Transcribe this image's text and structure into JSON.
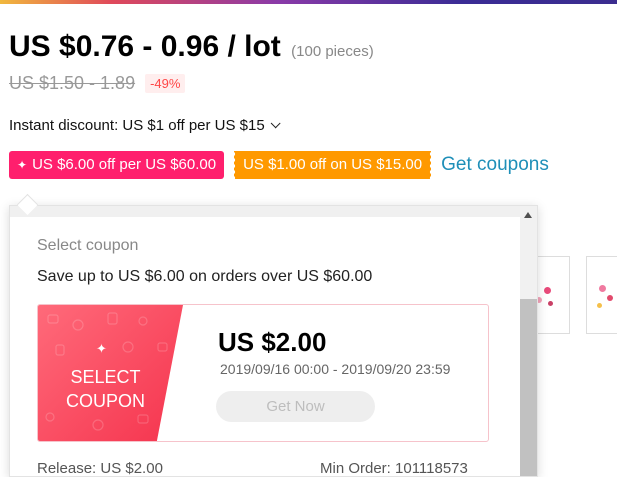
{
  "product": {
    "price_range": "US $0.76 - 0.96 / lot",
    "unit_note": "(100 pieces)",
    "original_price": "US $1.50 - 1.89",
    "discount_percent": "-49%"
  },
  "instant_discount": {
    "label": "Instant discount: US $1 off per US $15"
  },
  "coupon_tags": {
    "store_coupon": "US $6.00 off per US $60.00",
    "select_coupon": "US $1.00 off on US $15.00",
    "get_coupons_link": "Get coupons"
  },
  "popup": {
    "title": "Select coupon",
    "save_text": "Save up to US $6.00 on orders over US $60.00",
    "coupon": {
      "badge_label": "SELECT\nCOUPON",
      "amount": "US $2.00",
      "valid_dates": "2019/09/16 00:00 - 2019/09/20 23:59",
      "button_label": "Get Now"
    },
    "bottom_left": "Release: US $2.00",
    "bottom_right": "Min Order: 101118573"
  },
  "colors": {
    "store_coupon_bg": "#ff1f6d",
    "select_coupon_bg": "#ff9900",
    "link": "#1f8fb8",
    "discount_red": "#ff4747",
    "coupon_red": "#f5344e"
  },
  "icons": {
    "spark": "✦",
    "dropdown": "chevron-down-icon",
    "scroll_up": "triangle-up-icon"
  }
}
